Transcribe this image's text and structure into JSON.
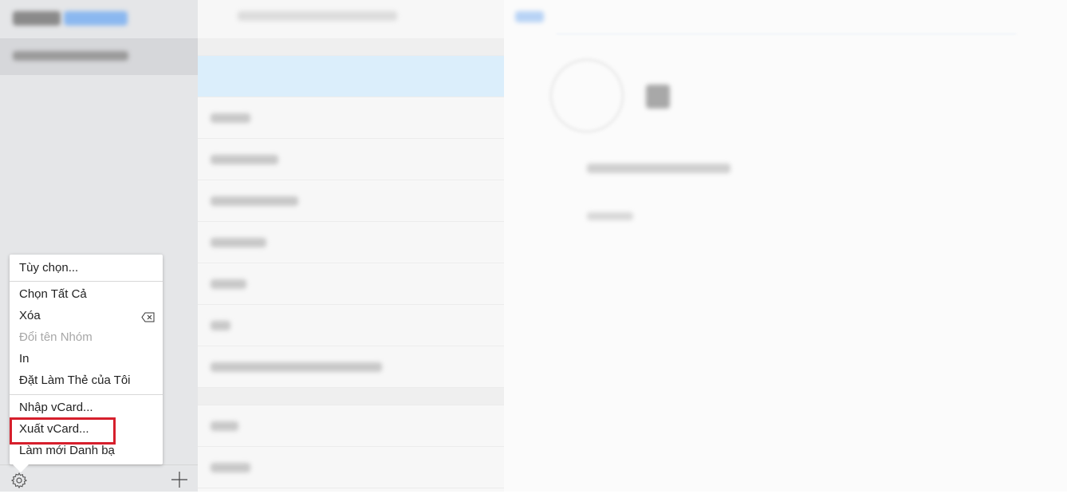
{
  "menu": {
    "items": [
      {
        "label": "Tùy chọn..."
      },
      {
        "label": "Chọn Tất Cả"
      },
      {
        "label": "Xóa"
      },
      {
        "label": "Đổi tên Nhóm",
        "disabled": true
      },
      {
        "label": "In"
      },
      {
        "label": "Đặt Làm Thẻ của Tôi"
      },
      {
        "label": "Nhập vCard..."
      },
      {
        "label": "Xuất vCard...",
        "highlighted": true
      },
      {
        "label": "Làm mới Danh bạ"
      }
    ],
    "delete_icon": "delete-backspace-icon"
  },
  "toolbar": {
    "settings_icon": "gear-icon",
    "add_icon": "plus-icon"
  },
  "colors": {
    "highlight_box": "#d61f2c",
    "selected_row": "#dbeefb",
    "accent": "#3b8ef0"
  }
}
